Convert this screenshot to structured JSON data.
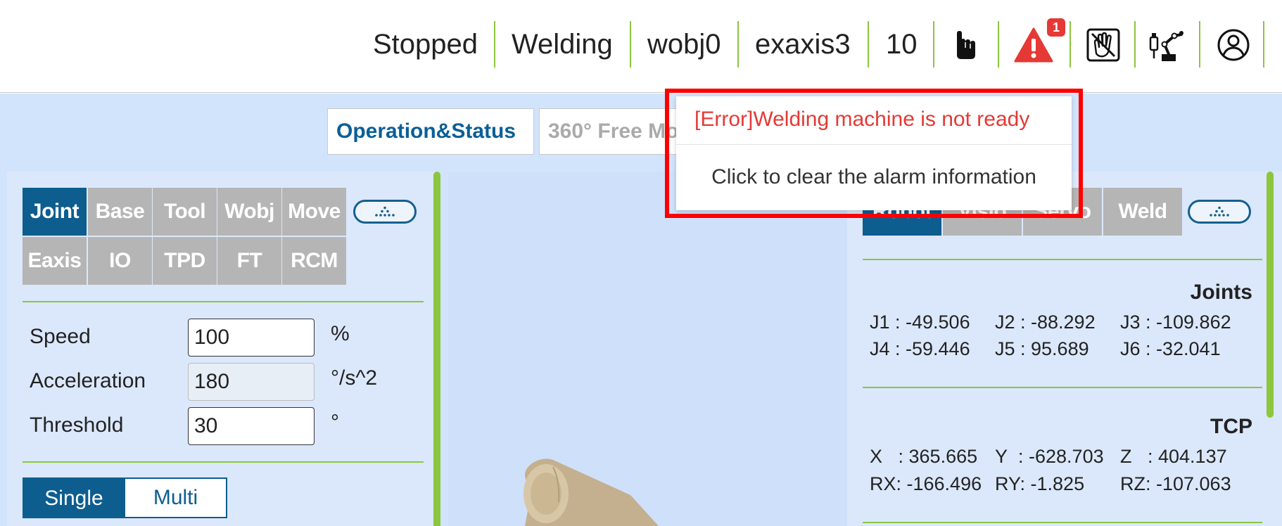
{
  "topbar": {
    "status": "Stopped",
    "mode": "Welding",
    "workobject": "wobj0",
    "ext_axis": "exaxis3",
    "speed": "10",
    "alarm_count": "1",
    "icons": [
      "hand-pointer-icon",
      "warning-icon",
      "hand-guide-icon",
      "robot-teach-icon",
      "user-icon"
    ],
    "colors": {
      "separator": "#8cc63f",
      "alarm": "#e53935"
    }
  },
  "tabs": {
    "operation": "Operation&Status",
    "free_view": "360° Free Mo"
  },
  "left_panel": {
    "buttons_row1": [
      "Joint",
      "Base",
      "Tool",
      "Wobj",
      "Move"
    ],
    "buttons_row2": [
      "Eaxis",
      "IO",
      "TPD",
      "FT",
      "RCM"
    ],
    "active": "Joint",
    "more_icon": "dots-icon",
    "form": {
      "speed_label": "Speed",
      "speed_value": "100",
      "speed_unit": "%",
      "accel_label": "Acceleration",
      "accel_value": "180",
      "accel_unit": "°/s^2",
      "threshold_label": "Threshold",
      "threshold_value": "30",
      "threshold_unit": "°"
    },
    "segment": {
      "single": "Single",
      "multi": "Multi"
    }
  },
  "right_panel": {
    "tabs": [
      "Robot",
      "Visio",
      "Servo",
      "Weld"
    ],
    "active": "Robot",
    "joints_title": "Joints",
    "joints": [
      "J1 : -49.506",
      "J2 : -88.292",
      "J3 : -109.862",
      "J4 : -59.446",
      "J5 : 95.689",
      "J6 : -32.041"
    ],
    "tcp_title": "TCP",
    "tcp": [
      "X   : 365.665",
      "Y  : -628.703",
      "Z   : 404.137",
      "RX: -166.496",
      "RY: -1.825",
      "RZ: -107.063"
    ]
  },
  "alarm": {
    "message": "[Error]Welding machine is not ready",
    "clear": "Click to clear the alarm information"
  }
}
